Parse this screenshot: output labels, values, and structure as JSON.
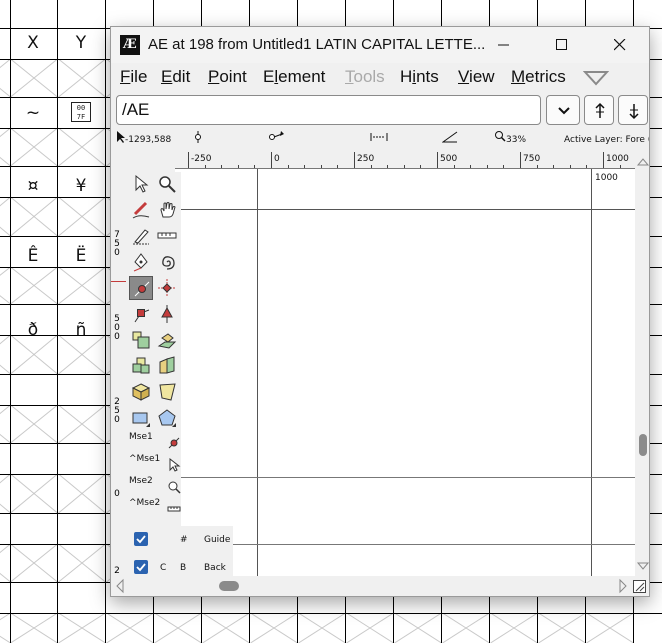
{
  "background": {
    "glyphs": [
      {
        "row": 0,
        "col": 0,
        "char": "X"
      },
      {
        "row": 0,
        "col": 1,
        "char": "Y"
      },
      {
        "row": 1,
        "col": 0,
        "char": "~"
      },
      {
        "row": 2,
        "col": 0,
        "char": "¤"
      },
      {
        "row": 2,
        "col": 1,
        "char": "¥"
      },
      {
        "row": 3,
        "col": 0,
        "char": "Ê"
      },
      {
        "row": 3,
        "col": 1,
        "char": "Ë"
      },
      {
        "row": 4,
        "col": 0,
        "char": "ð"
      },
      {
        "row": 4,
        "col": 1,
        "char": "ñ"
      }
    ],
    "missing_glyph_code_top": "00",
    "missing_glyph_code_bottom": "7F"
  },
  "window": {
    "icon_text": "Æ",
    "title": "AE at 198 from Untitled1 LATIN CAPITAL LETTE...",
    "icons": {
      "minimize": "minimize-icon",
      "maximize": "maximize-icon",
      "close": "close-icon"
    }
  },
  "menu": {
    "items": [
      {
        "first": "F",
        "rest": "ile",
        "disabled": false
      },
      {
        "first": "E",
        "rest": "dit",
        "disabled": false
      },
      {
        "first": "P",
        "rest": "oint",
        "disabled": false
      },
      {
        "first": "",
        "pre": "E",
        "mid": "l",
        "rest": "ement",
        "disabled": false
      },
      {
        "first": "T",
        "rest": "ools",
        "disabled": true
      },
      {
        "first": "",
        "pre": "H",
        "mid": "i",
        "rest": "nts",
        "disabled": false
      },
      {
        "first": "V",
        "rest": "iew",
        "disabled": false
      },
      {
        "first": "M",
        "rest": "etrics",
        "disabled": false
      }
    ],
    "labels": [
      "File",
      "Edit",
      "Point",
      "Element",
      "Tools",
      "Hints",
      "View",
      "Metrics"
    ]
  },
  "glyph_name": {
    "value": "/AE"
  },
  "inforow": {
    "coords": "-1293,588",
    "zoom": "33%",
    "active_layer": "Active Layer: Fore (F"
  },
  "ruler": {
    "ticks": [
      "-250",
      "0",
      "250",
      "500",
      "750",
      "1000"
    ],
    "vertical_labels": [
      [
        "7",
        "5",
        "0"
      ],
      [
        "5",
        "0",
        "0"
      ],
      [
        "2",
        "5",
        "0"
      ],
      [
        "0"
      ],
      [
        "2"
      ]
    ]
  },
  "canvas": {
    "corner_label": "1000"
  },
  "tools": {
    "mouse_labels": [
      "Mse1",
      "^Mse1",
      "Mse2",
      "^Mse2"
    ],
    "active": "curve-point-tool"
  },
  "layers": {
    "rows": [
      {
        "c1": "#",
        "c2": "",
        "name": "Guide"
      },
      {
        "c1": "C",
        "c2": "B",
        "name": "Back"
      }
    ]
  }
}
